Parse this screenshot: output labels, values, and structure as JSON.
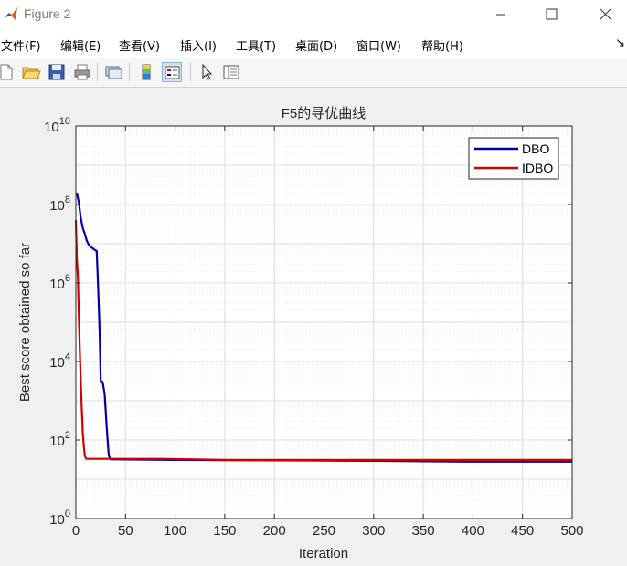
{
  "window": {
    "title": "Figure 2"
  },
  "menu": [
    "文件(F)",
    "编辑(E)",
    "查看(V)",
    "插入(I)",
    "工具(T)",
    "桌面(D)",
    "窗口(W)",
    "帮助(H)"
  ],
  "menu_overflow": "↘",
  "toolbar": [
    "new-figure",
    "open-file",
    "save",
    "print",
    "link-plot",
    "colorbar",
    "legend",
    "edit-plot",
    "property-inspector"
  ],
  "chart_data": {
    "type": "line",
    "title": "F5的寻优曲线",
    "xlabel": "Iteration",
    "ylabel": "Best score obtained so far",
    "xlim": [
      0,
      500
    ],
    "ylim": [
      1,
      10000000000
    ],
    "yscale": "log",
    "grid": true,
    "minor_grid": true,
    "legend_position": "top-right",
    "x_ticks": [
      "0",
      "50",
      "100",
      "150",
      "200",
      "250",
      "300",
      "350",
      "400",
      "450",
      "500"
    ],
    "y_ticks": [
      {
        "base": "10",
        "exp": "0"
      },
      {
        "base": "10",
        "exp": "2"
      },
      {
        "base": "10",
        "exp": "4"
      },
      {
        "base": "10",
        "exp": "6"
      },
      {
        "base": "10",
        "exp": "8"
      },
      {
        "base": "10",
        "exp": "10"
      }
    ],
    "series": [
      {
        "name": "DBO",
        "color": "#0000aa",
        "x": [
          1,
          3,
          5,
          7,
          9,
          11,
          13,
          16,
          19,
          21,
          22,
          23,
          24,
          25,
          27,
          29,
          31,
          33,
          34,
          35,
          37,
          40,
          100,
          250,
          400,
          500
        ],
        "y": [
          200000000,
          110000000,
          45000000,
          25000000,
          18000000,
          12000000,
          9500000,
          8000000,
          7000000,
          6500000,
          1500000,
          300000,
          50000,
          3200,
          3000,
          1500,
          220,
          45,
          35,
          32,
          32,
          32,
          31,
          30,
          28,
          28
        ]
      },
      {
        "name": "IDBO",
        "color": "#d00000",
        "x": [
          0,
          1,
          2,
          3,
          4,
          5,
          6,
          7,
          8,
          9,
          10,
          11,
          15,
          50,
          90,
          150,
          300,
          500
        ],
        "y": [
          40000000,
          4000000,
          1500000,
          130000,
          20000,
          3000,
          600,
          150,
          70,
          40,
          34,
          33,
          33,
          33,
          33,
          31,
          31,
          31
        ]
      }
    ]
  }
}
